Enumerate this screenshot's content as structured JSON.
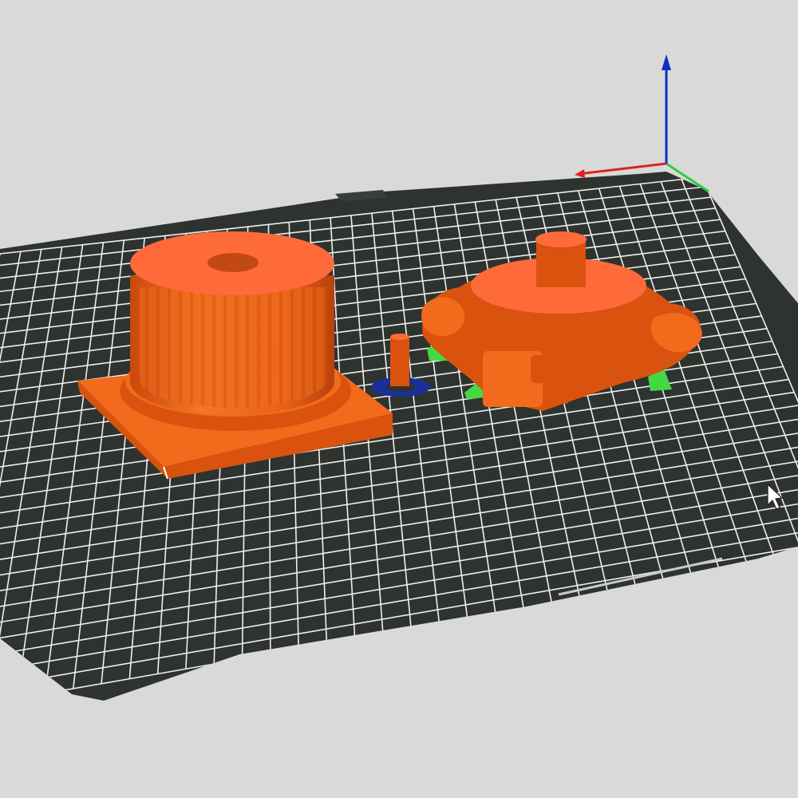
{
  "viewport": {
    "background": "#d9dad7",
    "bed_color": "#2e332f",
    "grid_color": "#eef0ee",
    "model_color": "#f26a1b",
    "model_shade": "#d9530f",
    "model_top": "#ff6a3a",
    "support_color": "#45d845",
    "brim_color": "#1a2f9a",
    "axis": {
      "x_color": "#e02020",
      "y_color": "#2ecc40",
      "z_color": "#1030c0"
    }
  },
  "objects": [
    {
      "id": "column-base",
      "kind": "fluted-column-with-square-plinth"
    },
    {
      "id": "small-pin",
      "kind": "thin-cylinder-with-brim"
    },
    {
      "id": "capital-part",
      "kind": "ornamental-capital-with-supports"
    }
  ],
  "cursor": {
    "icon": "arrow-cursor-icon"
  }
}
